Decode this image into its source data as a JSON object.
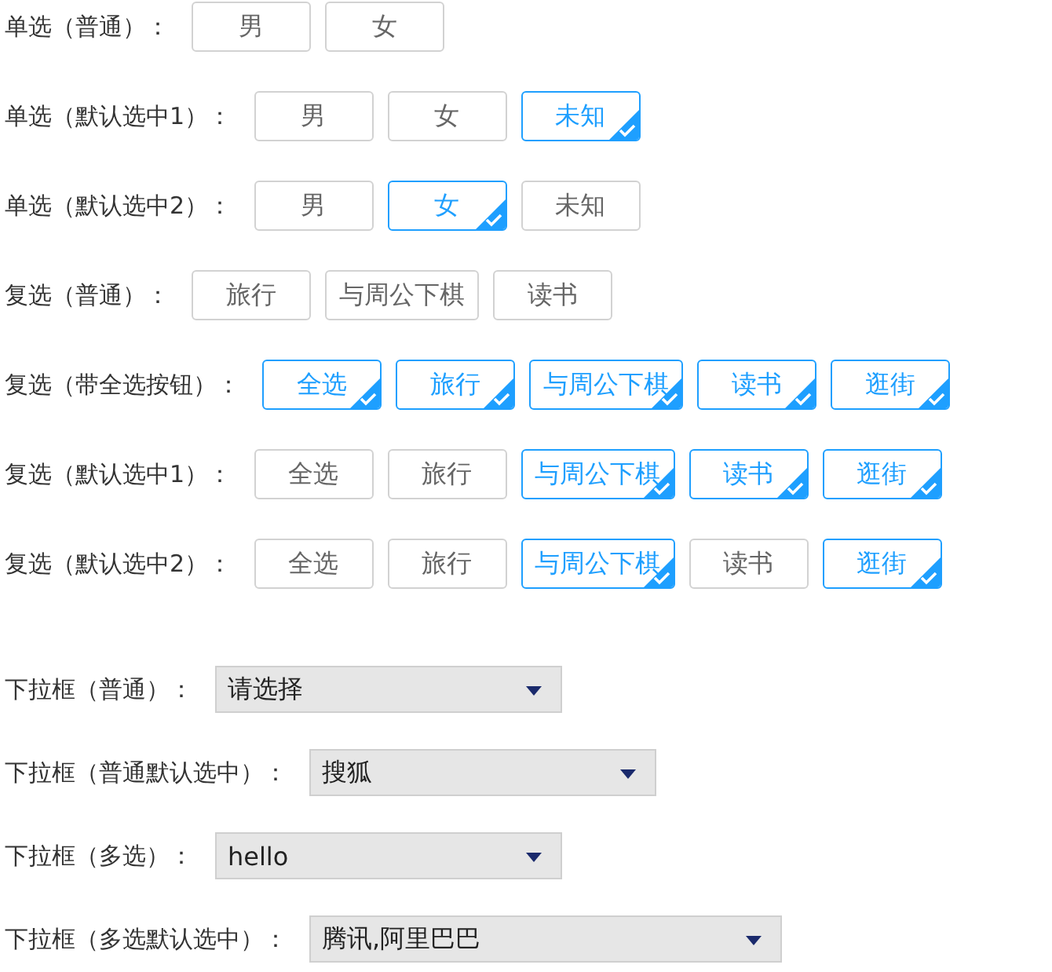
{
  "choice_rows": [
    {
      "label": "单选（普通）：",
      "options": [
        {
          "label": "男",
          "selected": false
        },
        {
          "label": "女",
          "selected": false
        }
      ]
    },
    {
      "label": "单选（默认选中1）：",
      "options": [
        {
          "label": "男",
          "selected": false
        },
        {
          "label": "女",
          "selected": false
        },
        {
          "label": "未知",
          "selected": true
        }
      ]
    },
    {
      "label": "单选（默认选中2）：",
      "options": [
        {
          "label": "男",
          "selected": false
        },
        {
          "label": "女",
          "selected": true
        },
        {
          "label": "未知",
          "selected": false
        }
      ]
    },
    {
      "label": "复选（普通）：",
      "options": [
        {
          "label": "旅行",
          "selected": false
        },
        {
          "label": "与周公下棋",
          "selected": false
        },
        {
          "label": "读书",
          "selected": false
        }
      ]
    },
    {
      "label": "复选（带全选按钮）：",
      "options": [
        {
          "label": "全选",
          "selected": true
        },
        {
          "label": "旅行",
          "selected": true
        },
        {
          "label": "与周公下棋",
          "selected": true
        },
        {
          "label": "读书",
          "selected": true
        },
        {
          "label": "逛街",
          "selected": true
        }
      ]
    },
    {
      "label": "复选（默认选中1）：",
      "options": [
        {
          "label": "全选",
          "selected": false
        },
        {
          "label": "旅行",
          "selected": false
        },
        {
          "label": "与周公下棋",
          "selected": true
        },
        {
          "label": "读书",
          "selected": true
        },
        {
          "label": "逛街",
          "selected": true
        }
      ]
    },
    {
      "label": "复选（默认选中2）：",
      "options": [
        {
          "label": "全选",
          "selected": false
        },
        {
          "label": "旅行",
          "selected": false
        },
        {
          "label": "与周公下棋",
          "selected": true
        },
        {
          "label": "读书",
          "selected": false
        },
        {
          "label": "逛街",
          "selected": true
        }
      ]
    }
  ],
  "dropdowns": [
    {
      "label": "下拉框（普通）：",
      "placeholder": "请选择"
    },
    {
      "label": "下拉框（普通默认选中）：",
      "value": "搜狐"
    },
    {
      "label": "下拉框（多选）：",
      "value": "hello"
    },
    {
      "label": "下拉框（多选默认选中）：",
      "value": "腾讯,阿里巴巴"
    }
  ]
}
